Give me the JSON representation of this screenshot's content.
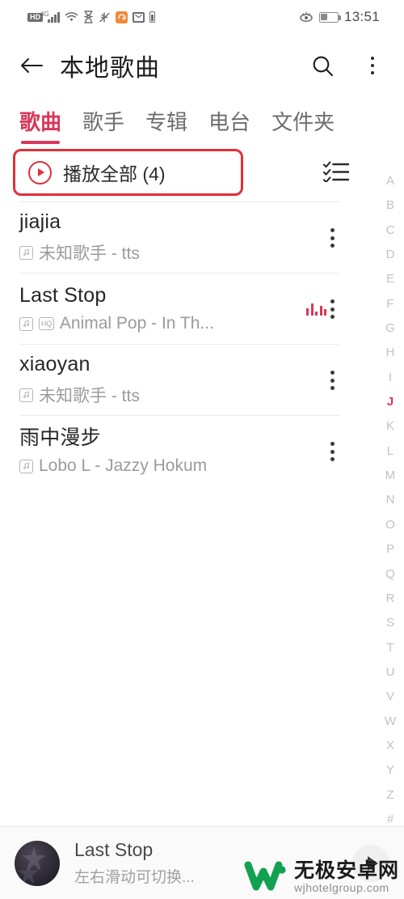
{
  "statusbar": {
    "hd_label": "HD",
    "network_label": "4G",
    "icons": [
      "hd-icon",
      "signal-icon",
      "wifi-icon",
      "hourglass-icon",
      "do-not-disturb-icon",
      "app-orange-icon",
      "message-icon",
      "battery-small-icon"
    ],
    "eye_icon": "eye-comfort-icon",
    "battery_level": 35,
    "time": "13:51"
  },
  "header": {
    "back_icon": "back-arrow-icon",
    "title": "本地歌曲",
    "search_icon": "search-icon",
    "menu_icon": "more-vertical-icon"
  },
  "tabs": [
    {
      "label": "歌曲",
      "active": true
    },
    {
      "label": "歌手",
      "active": false
    },
    {
      "label": "专辑",
      "active": false
    },
    {
      "label": "电台",
      "active": false
    },
    {
      "label": "文件夹",
      "active": false
    }
  ],
  "playall": {
    "label": "播放全部 (4)",
    "count": 4,
    "play_icon": "play-circle-icon",
    "multiselect_icon": "checklist-icon",
    "highlight_color": "#e03038"
  },
  "songs": [
    {
      "title": "jiajia",
      "subtitle": "未知歌手 - tts",
      "local_badge": "local-file-icon",
      "hq_badge": null,
      "playing": false,
      "more_icon": "more-vertical-icon"
    },
    {
      "title": "Last Stop",
      "subtitle": "Animal Pop - In Th...",
      "local_badge": "local-file-icon",
      "hq_badge": "HQ",
      "playing": true,
      "more_icon": "more-vertical-icon"
    },
    {
      "title": "xiaoyan",
      "subtitle": "未知歌手 - tts",
      "local_badge": "local-file-icon",
      "hq_badge": null,
      "playing": false,
      "more_icon": "more-vertical-icon"
    },
    {
      "title": "雨中漫步",
      "subtitle": "Lobo L - Jazzy Hokum",
      "local_badge": "local-file-icon",
      "hq_badge": null,
      "playing": false,
      "more_icon": "more-vertical-icon"
    }
  ],
  "alpha_index": {
    "letters": [
      "A",
      "B",
      "C",
      "D",
      "E",
      "F",
      "G",
      "H",
      "I",
      "J",
      "K",
      "L",
      "M",
      "N",
      "O",
      "P",
      "Q",
      "R",
      "S",
      "T",
      "U",
      "V",
      "W",
      "X",
      "Y",
      "Z",
      "#"
    ],
    "active": "J",
    "active_color": "#d8375a"
  },
  "player": {
    "album_art": "album-art-thumbnail",
    "title": "Last Stop",
    "subtitle": "左右滑动可切换...",
    "play_icon": "play-icon"
  },
  "watermark": {
    "logo_icon": "w-logo-icon",
    "cn": "无极安卓网",
    "en": "wjhotelgroup.com",
    "logo_color": "#12a150"
  },
  "theme": {
    "accent": "#d8375a",
    "highlight": "#e03038"
  }
}
